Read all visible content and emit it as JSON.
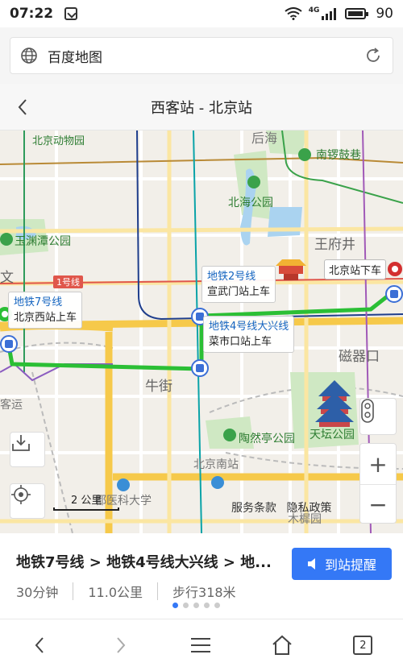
{
  "status": {
    "time": "07:22",
    "network": "4G",
    "battery": "90"
  },
  "address_bar": {
    "title": "百度地图"
  },
  "header": {
    "title": "西客站 - 北京站"
  },
  "map": {
    "labels": {
      "zoo": "北京动物园",
      "houhai": "后海",
      "nanluoguxiang": "南锣鼓巷",
      "beihai": "北海公园",
      "yuyuantan": "玉渊潭公园",
      "wangfujing": "王府井",
      "line1": "1号线",
      "niujie": "牛街",
      "ciqikou": "磁器口",
      "keyun": "客运",
      "taoranting": "陶然亭公园",
      "tiantan": "天坛公园",
      "beijingnan": "北京南站",
      "hospital": "都医科大学",
      "muxiyuan": "木樨园",
      "wen": "文"
    },
    "callouts": {
      "beijingxi": {
        "line": "地铁7号线",
        "station": "北京西站上车"
      },
      "xuanwumen": {
        "line": "地铁2号线",
        "station": "宣武门站上车"
      },
      "caishikou": {
        "line": "地铁4号线大兴线",
        "station": "菜市口站上车"
      },
      "beijingzhan": {
        "station": "北京站下车"
      }
    },
    "scale_label": "2 公里",
    "terms": "服务条款",
    "privacy": "隐私政策",
    "zoom_in": "+",
    "zoom_out": "−"
  },
  "route": {
    "name": "地铁7号线 > 地铁4号线大兴线 > 地...",
    "reminder_button": "到站提醒",
    "duration": "30分钟",
    "distance": "11.0公里",
    "walk": "步行318米",
    "page_count": 5,
    "active_page": 1
  },
  "browser": {
    "tab_count": "2"
  }
}
